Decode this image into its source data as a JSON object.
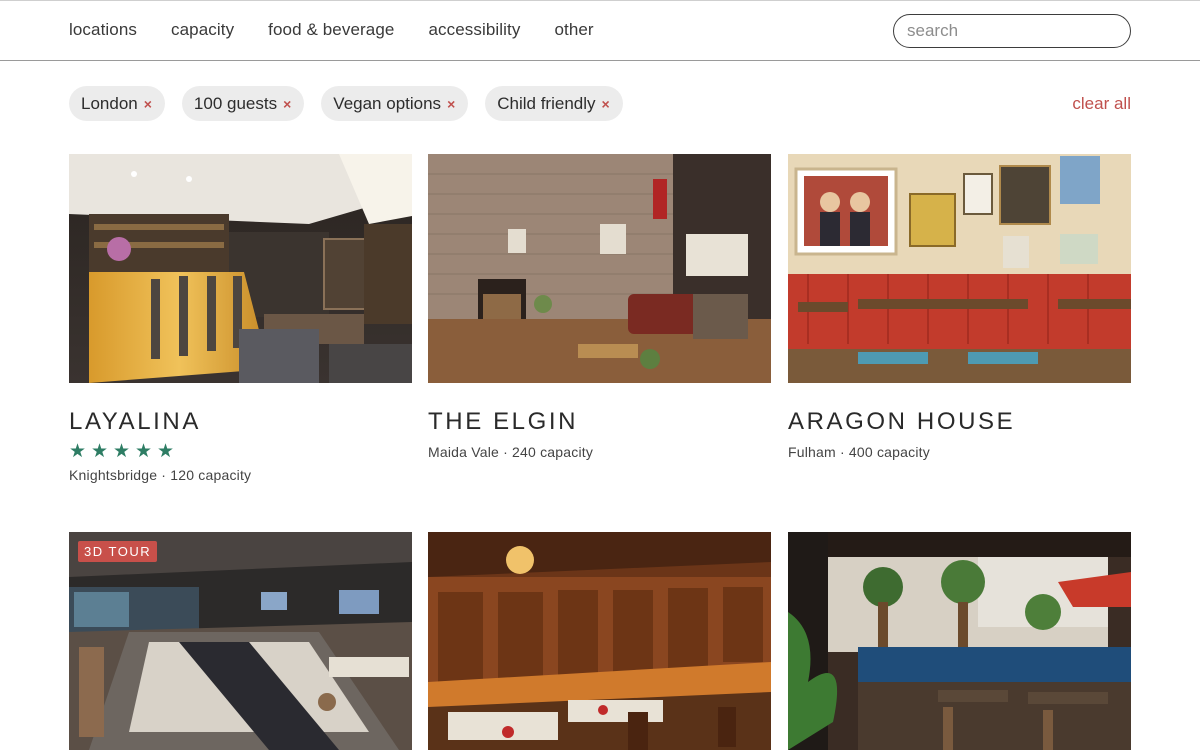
{
  "nav": {
    "items": [
      {
        "label": "locations"
      },
      {
        "label": "capacity"
      },
      {
        "label": "food & beverage"
      },
      {
        "label": "accessibility"
      },
      {
        "label": "other"
      }
    ],
    "search_placeholder": "search"
  },
  "filters": {
    "chips": [
      {
        "label": "London",
        "remove_icon": "×"
      },
      {
        "label": "100 guests",
        "remove_icon": "×"
      },
      {
        "label": "Vegan options",
        "remove_icon": "×"
      },
      {
        "label": "Child friendly",
        "remove_icon": "×"
      }
    ],
    "clear_label": "clear all"
  },
  "venues": [
    {
      "name": "LAYALINA",
      "rating": 5,
      "meta": "Knightsbridge · 120 capacity"
    },
    {
      "name": "THE ELGIN",
      "meta": "Maida Vale · 240 capacity"
    },
    {
      "name": "ARAGON HOUSE",
      "meta": "Fulham · 400 capacity"
    },
    {
      "badge": "3D TOUR"
    },
    {},
    {}
  ],
  "colors": {
    "accent_red": "#c0504d",
    "star_green": "#2e7d64",
    "chip_bg": "#ececec"
  }
}
